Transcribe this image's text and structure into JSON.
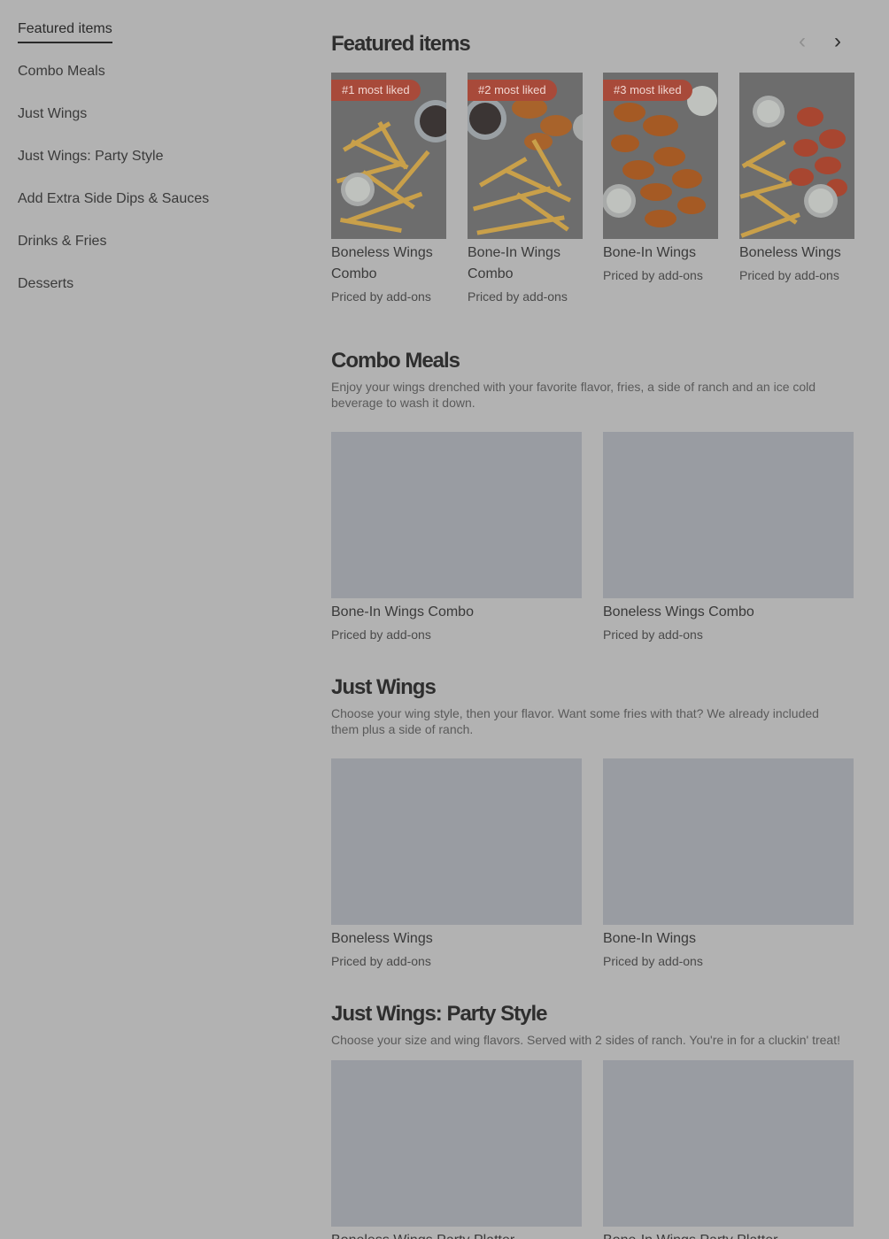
{
  "sidebar": {
    "items": [
      {
        "label": "Featured items",
        "active": true
      },
      {
        "label": "Combo Meals"
      },
      {
        "label": "Just Wings"
      },
      {
        "label": "Just Wings: Party Style"
      },
      {
        "label": "Add Extra Side Dips & Sauces"
      },
      {
        "label": "Drinks & Fries"
      },
      {
        "label": "Desserts"
      }
    ]
  },
  "featured": {
    "title": "Featured items",
    "prev_icon": "chevron-left-icon",
    "next_icon": "chevron-right-icon",
    "items": [
      {
        "badge": "#1 most liked",
        "title": "Boneless Wings Combo",
        "subtitle": "Priced by add-ons"
      },
      {
        "badge": "#2 most liked",
        "title": "Bone-In Wings Combo",
        "subtitle": "Priced by add-ons"
      },
      {
        "badge": "#3 most liked",
        "title": "Bone-In Wings",
        "subtitle": "Priced by add-ons"
      },
      {
        "badge": "",
        "title": "Boneless Wings",
        "subtitle": "Priced by add-ons"
      }
    ]
  },
  "combo": {
    "title": "Combo Meals",
    "description": "Enjoy your wings drenched with your favorite flavor, fries, a side of ranch and an ice cold beverage to wash it down.",
    "items": [
      {
        "title": "Bone-In Wings Combo",
        "subtitle": "Priced by add-ons"
      },
      {
        "title": "Boneless Wings Combo",
        "subtitle": "Priced by add-ons"
      }
    ]
  },
  "wings": {
    "title": "Just Wings",
    "description": "Choose your wing style, then your flavor. Want some fries with that? We already included them plus a side of ranch.",
    "items": [
      {
        "title": "Boneless Wings",
        "subtitle": "Priced by add-ons"
      },
      {
        "title": "Bone-In Wings",
        "subtitle": "Priced by add-ons"
      }
    ]
  },
  "party": {
    "title": "Just Wings: Party Style",
    "description": "Choose your size and wing flavors. Served with 2 sides of ranch. You're in for a cluckin' treat!",
    "items": [
      {
        "title": "Boneless Wings Party Platter",
        "subtitle": ""
      },
      {
        "title": "Bone-In Wings Party Platter",
        "subtitle": ""
      }
    ]
  },
  "colors": {
    "background": "#b2b2b2",
    "badge": "#a84a3a",
    "placeholder": "#999ca2"
  }
}
